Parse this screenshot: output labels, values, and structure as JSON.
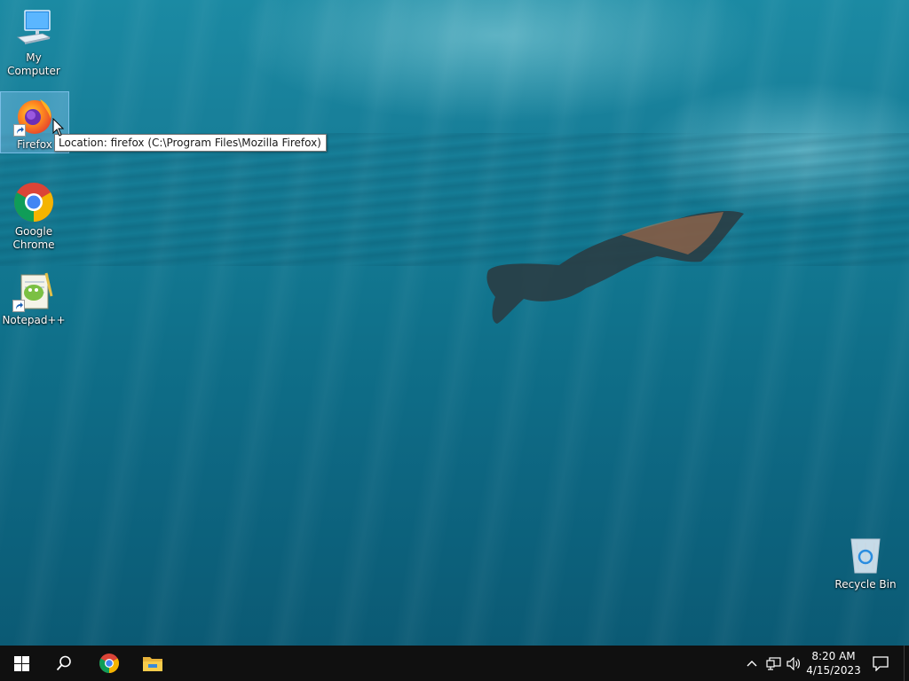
{
  "desktop": {
    "icons": [
      {
        "name": "my-computer",
        "label": "My Computer"
      },
      {
        "name": "firefox",
        "label": "Firefox"
      },
      {
        "name": "google-chrome",
        "label": "Google Chrome"
      },
      {
        "name": "notepad-plus-plus",
        "label": "Notepad++"
      },
      {
        "name": "recycle-bin",
        "label": "Recycle Bin"
      }
    ],
    "tooltip": "Location: firefox (C:\\Program Files\\Mozilla Firefox)"
  },
  "taskbar": {
    "start_icon": "windows-logo-icon",
    "search_icon": "search-icon",
    "pinned": [
      {
        "name": "chrome-icon"
      },
      {
        "name": "file-explorer-icon"
      }
    ],
    "tray_icons": [
      "chevron-up-icon",
      "network-icon",
      "volume-icon"
    ],
    "clock": {
      "time": "8:20 AM",
      "date": "4/15/2023"
    },
    "action_center_icon": "notification-icon"
  },
  "colors": {
    "taskbar_bg": "#101010",
    "water_top": "#1b8aa3",
    "water_bottom": "#0b5a74",
    "selection": "#99d1ff"
  }
}
